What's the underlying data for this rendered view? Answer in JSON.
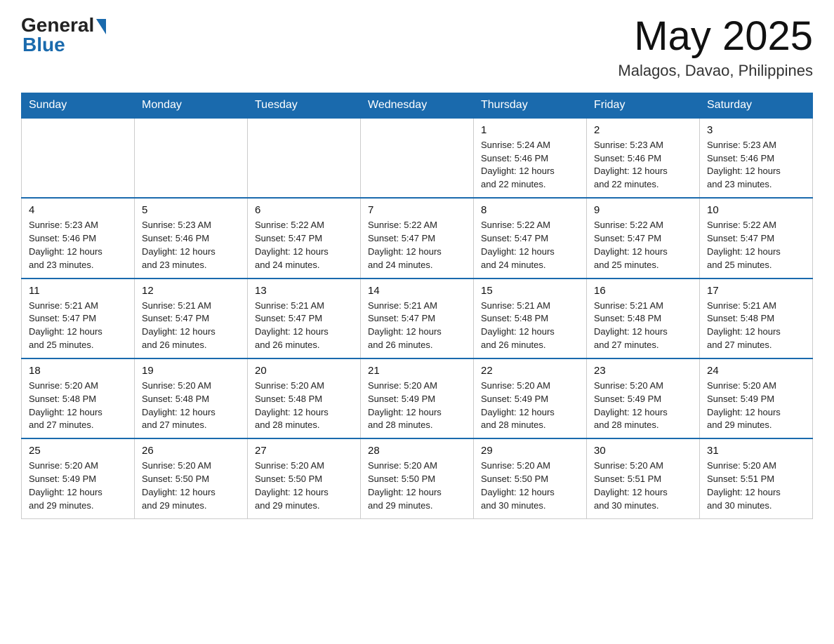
{
  "header": {
    "logo_general": "General",
    "logo_blue": "Blue",
    "month_title": "May 2025",
    "location": "Malagos, Davao, Philippines"
  },
  "weekdays": [
    "Sunday",
    "Monday",
    "Tuesday",
    "Wednesday",
    "Thursday",
    "Friday",
    "Saturday"
  ],
  "weeks": [
    [
      {
        "day": "",
        "info": ""
      },
      {
        "day": "",
        "info": ""
      },
      {
        "day": "",
        "info": ""
      },
      {
        "day": "",
        "info": ""
      },
      {
        "day": "1",
        "info": "Sunrise: 5:24 AM\nSunset: 5:46 PM\nDaylight: 12 hours\nand 22 minutes."
      },
      {
        "day": "2",
        "info": "Sunrise: 5:23 AM\nSunset: 5:46 PM\nDaylight: 12 hours\nand 22 minutes."
      },
      {
        "day": "3",
        "info": "Sunrise: 5:23 AM\nSunset: 5:46 PM\nDaylight: 12 hours\nand 23 minutes."
      }
    ],
    [
      {
        "day": "4",
        "info": "Sunrise: 5:23 AM\nSunset: 5:46 PM\nDaylight: 12 hours\nand 23 minutes."
      },
      {
        "day": "5",
        "info": "Sunrise: 5:23 AM\nSunset: 5:46 PM\nDaylight: 12 hours\nand 23 minutes."
      },
      {
        "day": "6",
        "info": "Sunrise: 5:22 AM\nSunset: 5:47 PM\nDaylight: 12 hours\nand 24 minutes."
      },
      {
        "day": "7",
        "info": "Sunrise: 5:22 AM\nSunset: 5:47 PM\nDaylight: 12 hours\nand 24 minutes."
      },
      {
        "day": "8",
        "info": "Sunrise: 5:22 AM\nSunset: 5:47 PM\nDaylight: 12 hours\nand 24 minutes."
      },
      {
        "day": "9",
        "info": "Sunrise: 5:22 AM\nSunset: 5:47 PM\nDaylight: 12 hours\nand 25 minutes."
      },
      {
        "day": "10",
        "info": "Sunrise: 5:22 AM\nSunset: 5:47 PM\nDaylight: 12 hours\nand 25 minutes."
      }
    ],
    [
      {
        "day": "11",
        "info": "Sunrise: 5:21 AM\nSunset: 5:47 PM\nDaylight: 12 hours\nand 25 minutes."
      },
      {
        "day": "12",
        "info": "Sunrise: 5:21 AM\nSunset: 5:47 PM\nDaylight: 12 hours\nand 26 minutes."
      },
      {
        "day": "13",
        "info": "Sunrise: 5:21 AM\nSunset: 5:47 PM\nDaylight: 12 hours\nand 26 minutes."
      },
      {
        "day": "14",
        "info": "Sunrise: 5:21 AM\nSunset: 5:47 PM\nDaylight: 12 hours\nand 26 minutes."
      },
      {
        "day": "15",
        "info": "Sunrise: 5:21 AM\nSunset: 5:48 PM\nDaylight: 12 hours\nand 26 minutes."
      },
      {
        "day": "16",
        "info": "Sunrise: 5:21 AM\nSunset: 5:48 PM\nDaylight: 12 hours\nand 27 minutes."
      },
      {
        "day": "17",
        "info": "Sunrise: 5:21 AM\nSunset: 5:48 PM\nDaylight: 12 hours\nand 27 minutes."
      }
    ],
    [
      {
        "day": "18",
        "info": "Sunrise: 5:20 AM\nSunset: 5:48 PM\nDaylight: 12 hours\nand 27 minutes."
      },
      {
        "day": "19",
        "info": "Sunrise: 5:20 AM\nSunset: 5:48 PM\nDaylight: 12 hours\nand 27 minutes."
      },
      {
        "day": "20",
        "info": "Sunrise: 5:20 AM\nSunset: 5:48 PM\nDaylight: 12 hours\nand 28 minutes."
      },
      {
        "day": "21",
        "info": "Sunrise: 5:20 AM\nSunset: 5:49 PM\nDaylight: 12 hours\nand 28 minutes."
      },
      {
        "day": "22",
        "info": "Sunrise: 5:20 AM\nSunset: 5:49 PM\nDaylight: 12 hours\nand 28 minutes."
      },
      {
        "day": "23",
        "info": "Sunrise: 5:20 AM\nSunset: 5:49 PM\nDaylight: 12 hours\nand 28 minutes."
      },
      {
        "day": "24",
        "info": "Sunrise: 5:20 AM\nSunset: 5:49 PM\nDaylight: 12 hours\nand 29 minutes."
      }
    ],
    [
      {
        "day": "25",
        "info": "Sunrise: 5:20 AM\nSunset: 5:49 PM\nDaylight: 12 hours\nand 29 minutes."
      },
      {
        "day": "26",
        "info": "Sunrise: 5:20 AM\nSunset: 5:50 PM\nDaylight: 12 hours\nand 29 minutes."
      },
      {
        "day": "27",
        "info": "Sunrise: 5:20 AM\nSunset: 5:50 PM\nDaylight: 12 hours\nand 29 minutes."
      },
      {
        "day": "28",
        "info": "Sunrise: 5:20 AM\nSunset: 5:50 PM\nDaylight: 12 hours\nand 29 minutes."
      },
      {
        "day": "29",
        "info": "Sunrise: 5:20 AM\nSunset: 5:50 PM\nDaylight: 12 hours\nand 30 minutes."
      },
      {
        "day": "30",
        "info": "Sunrise: 5:20 AM\nSunset: 5:51 PM\nDaylight: 12 hours\nand 30 minutes."
      },
      {
        "day": "31",
        "info": "Sunrise: 5:20 AM\nSunset: 5:51 PM\nDaylight: 12 hours\nand 30 minutes."
      }
    ]
  ],
  "colors": {
    "header_bg": "#1a6aad",
    "header_text": "#ffffff",
    "border": "#1a6aad",
    "cell_border": "#cccccc"
  }
}
